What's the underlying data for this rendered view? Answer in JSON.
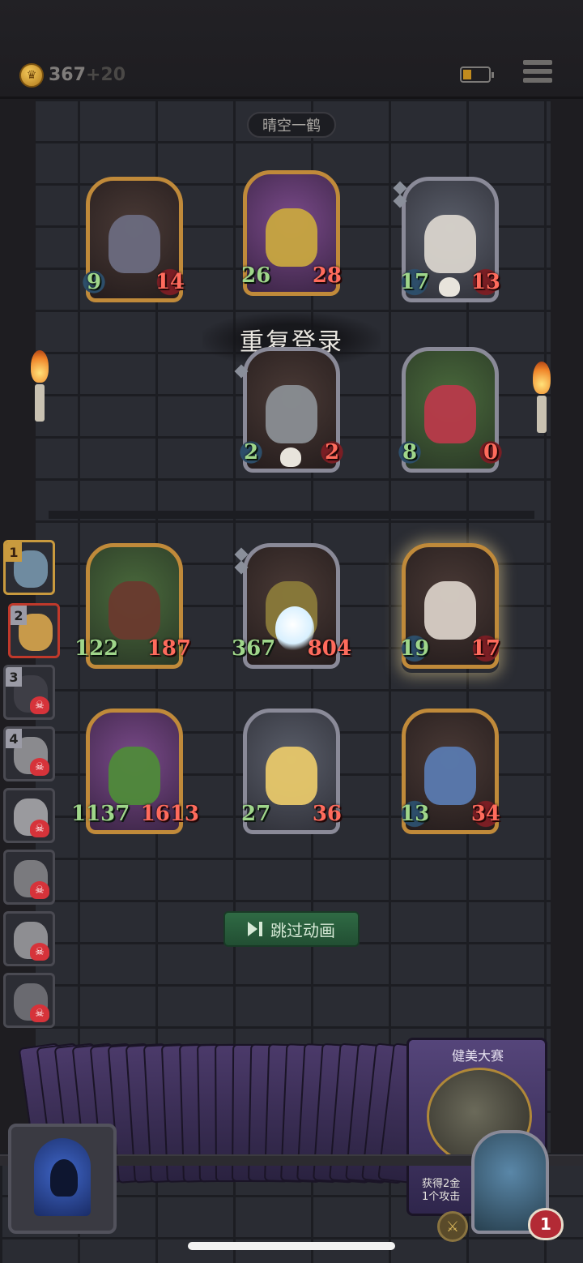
{
  "topbar": {
    "gold_icon": "crown-coin-icon",
    "gold": "367",
    "gold_bonus": "+20",
    "battery_icon": "battery-low-icon",
    "menu_icon": "hamburger-menu-icon"
  },
  "opponent": {
    "name": "晴空一鹤"
  },
  "banner": {
    "text": "重复登录"
  },
  "enemy_row1": [
    {
      "portrait": "hyena-bandit",
      "atk": "9",
      "hp": "14"
    },
    {
      "portrait": "mosquito-robot",
      "atk": "26",
      "hp": "28"
    },
    {
      "portrait": "old-pirate",
      "atk": "17",
      "hp": "13"
    }
  ],
  "enemy_row2": [
    {
      "portrait": "bell-robot",
      "atk": "2",
      "hp": "2"
    },
    {
      "portrait": "clown",
      "atk": "8",
      "hp": "0"
    }
  ],
  "player_row1": [
    {
      "portrait": "boar-beast",
      "atk": "122",
      "hp": "187"
    },
    {
      "portrait": "witch-hat-wizard",
      "atk": "367",
      "hp": "804"
    },
    {
      "portrait": "scarred-rat-warrior",
      "atk": "19",
      "hp": "17"
    }
  ],
  "player_row2": [
    {
      "portrait": "leaf-child",
      "atk": "1137",
      "hp": "1613"
    },
    {
      "portrait": "fairy",
      "atk": "27",
      "hp": "36"
    },
    {
      "portrait": "blue-haired-elf",
      "atk": "13",
      "hp": "34"
    }
  ],
  "roster": [
    {
      "rank": "1",
      "status": "alive"
    },
    {
      "rank": "2",
      "status": "active"
    },
    {
      "rank": "3",
      "status": "dead"
    },
    {
      "rank": "4",
      "status": "dead"
    },
    {
      "rank": "",
      "status": "dead"
    },
    {
      "rank": "",
      "status": "dead"
    },
    {
      "rank": "",
      "status": "dead"
    },
    {
      "rank": "",
      "status": "dead"
    }
  ],
  "skip_button": {
    "label": "跳过动画",
    "icon": "skip-forward-icon"
  },
  "hand": {
    "feature_card_title": "健美大赛",
    "feature_card_desc_line1": "获得2金",
    "feature_card_desc_line2": "1个攻击"
  },
  "hero": {
    "lives": "1",
    "sword_icon": "sword-badge-icon"
  },
  "colors": {
    "atk": "#9fd68a",
    "hp": "#ff6b5c",
    "gold_frame": "#c08a3a",
    "button_green": "#2f6a44"
  }
}
